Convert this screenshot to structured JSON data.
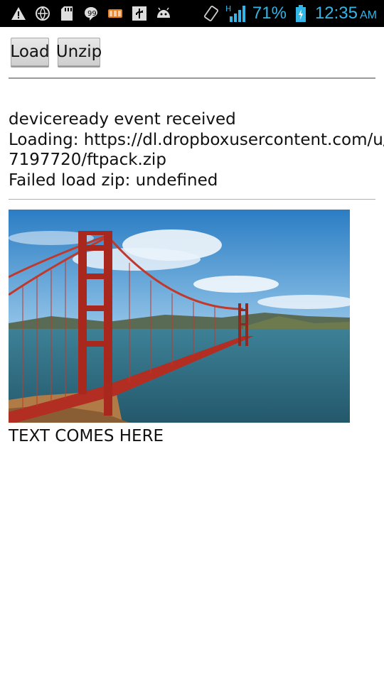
{
  "status_bar": {
    "battery_percent": "71%",
    "network_type": "H",
    "time": "12:35",
    "ampm": "AM",
    "icons": [
      "warning-icon",
      "browser-icon",
      "sd-card-icon",
      "chat-icon",
      "app-icon",
      "usb-icon",
      "android-icon",
      "rotation-icon",
      "signal-icon",
      "battery-charging-icon"
    ]
  },
  "toolbar": {
    "load_label": "Load",
    "unzip_label": "Unzip"
  },
  "log": {
    "lines": [
      "deviceready event received",
      "Loading: https://dl.dropboxusercontent.com/u/",
      "7197720/ftpack.zip",
      "Failed load zip: undefined"
    ]
  },
  "image": {
    "subject": "golden-gate-bridge-photo"
  },
  "caption": "TEXT COMES HERE",
  "colors": {
    "status_bar_bg": "#000000",
    "status_accent": "#33b5e5",
    "bridge_red": "#c0392b",
    "sky": "#3f8ed0",
    "water": "#2f6f85"
  }
}
